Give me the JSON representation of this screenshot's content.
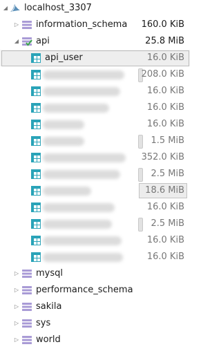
{
  "connection": {
    "name": "localhost_3307",
    "icon": "dolphin-server-icon"
  },
  "databases": [
    {
      "name": "information_schema",
      "size": "160.0 KiB",
      "expanded": false
    },
    {
      "name": "api",
      "size": "25.8 MiB",
      "expanded": true
    },
    {
      "name": "mysql",
      "size": "",
      "expanded": false
    },
    {
      "name": "performance_schema",
      "size": "",
      "expanded": false
    },
    {
      "name": "sakila",
      "size": "",
      "expanded": false
    },
    {
      "name": "sys",
      "size": "",
      "expanded": false
    },
    {
      "name": "world",
      "size": "",
      "expanded": false
    }
  ],
  "tables": [
    {
      "name": "api_user",
      "size": "16.0 KiB",
      "selected": true,
      "name_hidden": false
    },
    {
      "name": "",
      "size": "208.0 KiB",
      "name_hidden": true
    },
    {
      "name": "",
      "size": "16.0 KiB",
      "name_hidden": true
    },
    {
      "name": "",
      "size": "16.0 KiB",
      "name_hidden": true
    },
    {
      "name": "",
      "size": "16.0 KiB",
      "name_hidden": true
    },
    {
      "name": "",
      "size": "1.5 MiB",
      "name_hidden": true
    },
    {
      "name": "",
      "size": "352.0 KiB",
      "name_hidden": true
    },
    {
      "name": "",
      "size": "2.5 MiB",
      "name_hidden": true
    },
    {
      "name": "",
      "size": "18.6 MiB",
      "name_hidden": true,
      "highlighted": true
    },
    {
      "name": "",
      "size": "16.0 KiB",
      "name_hidden": true
    },
    {
      "name": "",
      "size": "2.5 MiB",
      "name_hidden": true
    },
    {
      "name": "",
      "size": "16.0 KiB",
      "name_hidden": true
    },
    {
      "name": "",
      "size": "16.0 KiB",
      "name_hidden": true
    }
  ],
  "colors": {
    "db_icon": "#a99bd6",
    "table_icon": "#2aa3b8",
    "open_db_check": "#3aa64a",
    "selection": "#eeeeee"
  }
}
